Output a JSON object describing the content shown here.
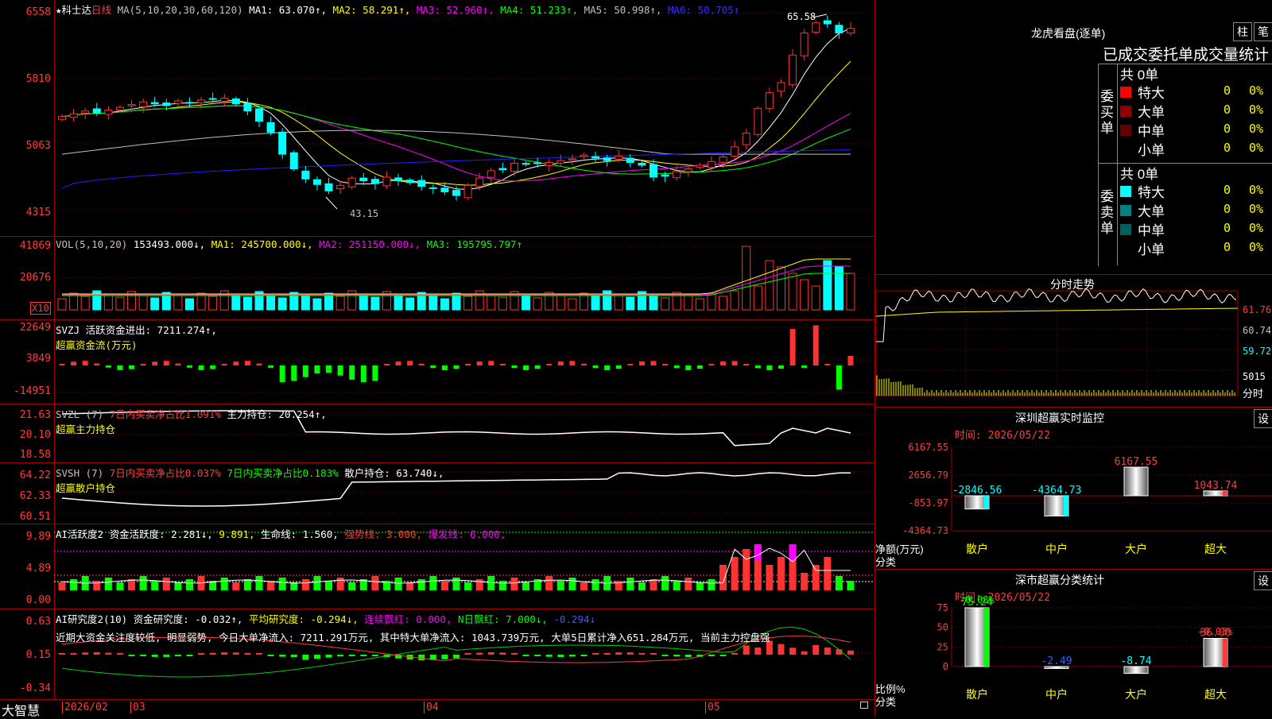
{
  "app": {
    "name": "大智慧",
    "stock": "科士达",
    "period": "日线"
  },
  "colors": {
    "up": "#ff3232",
    "down": "#00ffff",
    "grid": "#a00000",
    "ma1": "#ffffff",
    "ma2": "#ffff00",
    "ma3": "#ff00ff",
    "ma4": "#00ff00",
    "ma5": "#c0c0c0",
    "ma6": "#2020ff"
  },
  "price_panel": {
    "ma_label": "MA(5,10,20,30,60,120)",
    "ma_items": [
      {
        "label": "MA1: 63.070↑,",
        "color": "#ffffff"
      },
      {
        "label": "MA2: 58.291↑,",
        "color": "#ffff00"
      },
      {
        "label": "MA3: 52.960↑,",
        "color": "#ff00ff"
      },
      {
        "label": "MA4: 51.233↑,",
        "color": "#00ff00"
      },
      {
        "label": "MA5: 50.998↑,",
        "color": "#c0c0c0"
      },
      {
        "label": "MA6: 50.705↑",
        "color": "#3030ff"
      }
    ],
    "ticks": [
      "6558",
      "5810",
      "5063",
      "4315"
    ],
    "high_label": "65.58",
    "low_label": "43.15"
  },
  "vol_panel": {
    "label": "VOL(5,10,20)",
    "value": "153493.000↓,",
    "items": [
      {
        "label": "MA1: 245700.000↓,",
        "color": "#ffff00"
      },
      {
        "label": "MA2: 251150.000↓,",
        "color": "#ff00ff"
      },
      {
        "label": "MA3: 195795.797↑",
        "color": "#00ff00"
      }
    ],
    "ticks": [
      "41869",
      "20676"
    ],
    "unit": "X10"
  },
  "svzj_panel": {
    "label": "SVZJ  活跃资金进出: 7211.274↑,",
    "sub": "超赢资金流(万元)",
    "ticks": [
      "22649",
      "3849",
      "-14951"
    ]
  },
  "svzl_panel": {
    "label": "SVZL (7)",
    "red": "7日内买卖净占比1.091%",
    "white": "主力持仓: 20.254↑,",
    "sub": "超赢主力持仓",
    "ticks": [
      "21.63",
      "20.10",
      "18.58"
    ]
  },
  "svsh_panel": {
    "label": "SVSH (7)",
    "red": "7日内买卖净占比0.037%",
    "green": "7日内买卖净占比0.183%",
    "white": "散户持仓: 63.740↓,",
    "sub": "超赢散户持仓",
    "ticks": [
      "64.22",
      "62.33",
      "60.51"
    ]
  },
  "ai_panel": {
    "label": "AI活跃度2 资金活跃度: 2.281↓,",
    "v2": "9.891,",
    "life": "生命线: 1.560,",
    "strong": "强势线: 3.000,",
    "burst": "爆发线: 6.000,",
    "ticks": [
      "9.89",
      "4.89",
      "0.00"
    ]
  },
  "research_panel": {
    "label": "AI研究度2(10) 资金研究度: -0.032↑,",
    "avg": "平均研究度: -0.294↓,",
    "lx": "连续飘红: 0.000,",
    "n": "N日飘红: 7.000↓,",
    "last": "-0.294↓",
    "comment": "近期大资金关注度较低, 明显弱势, 今日大单净流入: 7211.291万元, 其中特大单净流入: 1043.739万元, 大单5日累计净入651.284万元, 当前主力控盘强",
    "ticks": [
      "0.63",
      "0.15",
      "-0.34"
    ]
  },
  "dates": [
    "2026/02",
    "03",
    "04",
    "05"
  ],
  "right": {
    "title": "龙虎看盘(逐单)",
    "btn_bar": "柱",
    "btn_pen": "笔",
    "tabs": "已成交委托单成交量统计",
    "buy_label": "委买单",
    "sell_label": "委卖单",
    "buy_total": "共 0单",
    "sell_total": "共 0单",
    "buy_rows": [
      {
        "name": "特大",
        "qty": "0",
        "pct": "0%",
        "color": "#ff0000"
      },
      {
        "name": "大单",
        "qty": "0",
        "pct": "0%",
        "color": "#900000"
      },
      {
        "name": "中单",
        "qty": "0",
        "pct": "0%",
        "color": "#600000"
      },
      {
        "name": "小单",
        "qty": "0",
        "pct": "0%",
        "color": "#000000"
      }
    ],
    "sell_rows": [
      {
        "name": "特大",
        "qty": "0",
        "pct": "0%",
        "color": "#00ffff"
      },
      {
        "name": "大单",
        "qty": "0",
        "pct": "0%",
        "color": "#008080"
      },
      {
        "name": "中单",
        "qty": "0",
        "pct": "0%",
        "color": "#006060"
      },
      {
        "name": "小单",
        "qty": "0",
        "pct": "0%",
        "color": "#000000"
      }
    ],
    "intraday": {
      "title": "分时走势",
      "ticks": [
        "61.76",
        "60.74",
        "59.72",
        "5015",
        "分时"
      ]
    },
    "monitor": {
      "title": "深圳超赢实时监控",
      "btn": "设",
      "time": "时间: 2026/05/22",
      "ticks": [
        "6167.55",
        "2656.79",
        "-853.97",
        "-4364.73"
      ],
      "axis_note1": "净额(万元)",
      "axis_note2": "分类",
      "categories": [
        "散户",
        "中户",
        "大户",
        "超大"
      ],
      "values": [
        -2846.56,
        -4364.73,
        6167.55,
        1043.74
      ],
      "value_labels": [
        "-2846.56",
        "-4364.73",
        "6167.55",
        "1043.74"
      ]
    },
    "classify": {
      "title": "深市超赢分类统计",
      "btn": "设",
      "time": "时间: 2026/05/22",
      "ticks": [
        "75",
        "50",
        "25",
        "0"
      ],
      "axis_note1": "比例%",
      "axis_note2": "分类",
      "categories": [
        "散户",
        "中户",
        "大户",
        "超大"
      ],
      "values": [
        75.24,
        -2.49,
        -8.74,
        36.0
      ],
      "value_labels": [
        "75.24",
        "-2.49",
        "-8.74",
        "36.00"
      ],
      "delta_labels": [
        "-0.08%",
        "+0.03%"
      ]
    }
  },
  "chart_data": [
    {
      "type": "candlestick",
      "title": "科士达 日线",
      "ylim": [
        43.15,
        65.58
      ],
      "high": 65.58,
      "low": 43.15,
      "close": [
        54.6,
        54.9,
        55.2,
        55.0,
        55.3,
        55.6,
        55.9,
        56.2,
        56.0,
        55.8,
        56.3,
        56.1,
        56.4,
        56.5,
        56.6,
        56.0,
        55.2,
        54.1,
        52.9,
        50.5,
        48.9,
        47.8,
        47.2,
        46.5,
        47.1,
        47.9,
        47.6,
        47.3,
        48.0,
        47.6,
        47.4,
        47.0,
        46.8,
        46.4,
        46.0,
        47.1,
        47.9,
        48.7,
        48.8,
        49.5,
        49.4,
        49.5,
        49.6,
        49.8,
        50.0,
        50.4,
        50.1,
        49.8,
        50.3,
        49.6,
        49.3,
        48.0,
        48.1,
        48.6,
        48.9,
        49.3,
        49.7,
        50.2,
        51.3,
        52.8,
        55.5,
        57.2,
        58.3,
        61.3,
        63.7,
        64.8,
        64.7,
        63.7,
        64.2
      ]
    },
    {
      "type": "bar",
      "title": "VOL(5,10,20)",
      "series_value_last": 153493
    },
    {
      "type": "bar",
      "title": "深圳超赢实时监控",
      "categories": [
        "散户",
        "中户",
        "大户",
        "超大"
      ],
      "values": [
        -2846.56,
        -4364.73,
        6167.55,
        1043.74
      ],
      "ylabel": "净额(万元)",
      "ylim": [
        -4364.73,
        6167.55
      ]
    },
    {
      "type": "bar",
      "title": "深市超赢分类统计",
      "categories": [
        "散户",
        "中户",
        "大户",
        "超大"
      ],
      "values": [
        75.24,
        -2.49,
        -8.74,
        36.0
      ],
      "ylabel": "比例%",
      "ylim": [
        0,
        75
      ]
    }
  ]
}
